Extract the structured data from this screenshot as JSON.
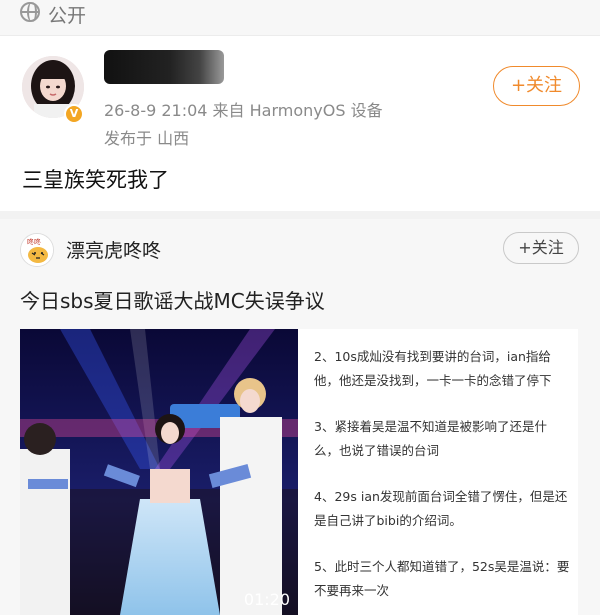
{
  "visibility": {
    "label": "公开",
    "icon": "globe-icon"
  },
  "post": {
    "meta": "26-8-9 21:04  来自 HarmonyOS 设备",
    "location": "发布于 山西",
    "follow_label": "+关注",
    "text": "三皇族笑死我了",
    "verified_icon": "verified-badge-icon",
    "accent_color": "#f08a2c"
  },
  "repost": {
    "author": "漂亮虎咚咚",
    "follow_label": "+关注",
    "title": "今日sbs夏日歌谣大战MC失误争议",
    "video": {
      "duration": "01:20",
      "icon": "video-thumbnail"
    },
    "notes": [
      "2、10s成灿没有找到要讲的台词，ian指给",
      "他，他还是没找到，一卡一卡的念错了停下",
      "3、紧接着吴是温不知道是被影响了还是什",
      "么，也说了错误的台词",
      "4、29s ian发现前面台词全错了愣住，但是还",
      "是自己讲了bibi的介绍词。",
      "5、此时三个人都知道错了，52s吴是温说：要",
      "不要再来一次"
    ]
  }
}
